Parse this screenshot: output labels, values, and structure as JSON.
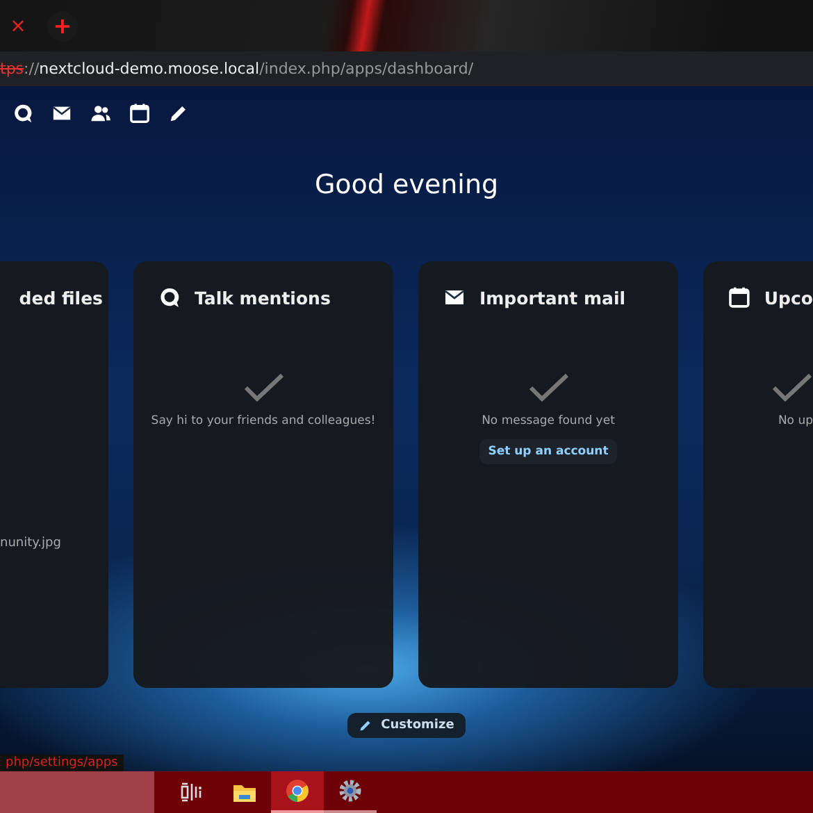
{
  "browser": {
    "tab_close": "×",
    "new_tab": "+",
    "address": {
      "scheme": "tps",
      "separator": "://",
      "host": "nextcloud-demo.moose.local",
      "path": "/index.php/apps/dashboard/"
    }
  },
  "app_nav": [
    {
      "kind": "talk"
    },
    {
      "kind": "mail"
    },
    {
      "kind": "contacts"
    },
    {
      "kind": "calendar"
    },
    {
      "kind": "notes"
    }
  ],
  "greeting": "Good evening",
  "widgets": [
    {
      "kind": "files",
      "title": "ded files",
      "items": [
        "nunity.jpg"
      ]
    },
    {
      "kind": "talk",
      "title": "Talk mentions",
      "message": "Say hi to your friends and colleagues!"
    },
    {
      "kind": "mail",
      "title": "Important mail",
      "message": "No message found yet",
      "action": "Set up an account"
    },
    {
      "kind": "calendar",
      "title": "Upco",
      "message": "No up"
    }
  ],
  "customize_button": "Customize",
  "status_link": "php/settings/apps",
  "taskbar": [
    {
      "kind": "search",
      "selected": false
    },
    {
      "kind": "taskview",
      "selected": false
    },
    {
      "kind": "explorer",
      "selected": false
    },
    {
      "kind": "chrome",
      "selected": true
    },
    {
      "kind": "settings",
      "selected": false
    }
  ]
}
